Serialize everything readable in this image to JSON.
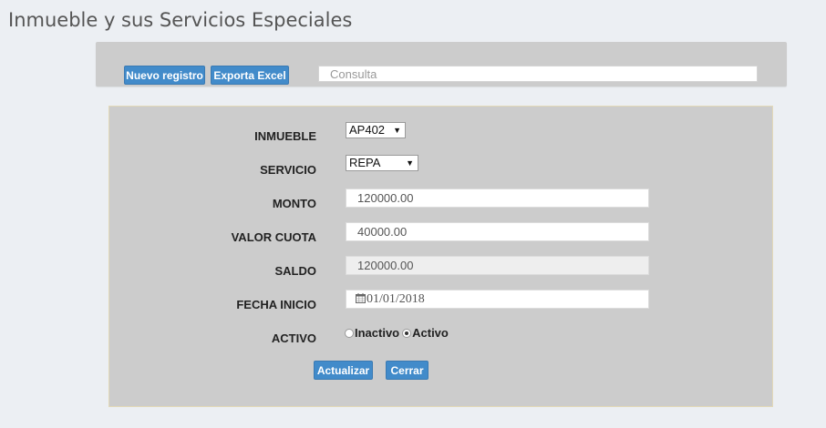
{
  "page": {
    "title": "Inmueble y sus Servicios Especiales"
  },
  "toolbar": {
    "new_label": "Nuevo registro",
    "export_label": "Exporta Excel",
    "search_placeholder": "Consulta"
  },
  "form": {
    "inmueble": {
      "label": "INMUEBLE",
      "value": "AP402"
    },
    "servicio": {
      "label": "SERVICIO",
      "value": "REPA"
    },
    "monto": {
      "label": "MONTO",
      "value": "120000.00"
    },
    "valor_cuota": {
      "label": "VALOR CUOTA",
      "value": "40000.00"
    },
    "saldo": {
      "label": "SALDO",
      "value": "120000.00"
    },
    "fecha_inicio": {
      "label": "FECHA INICIO",
      "value": "01/01/2018"
    },
    "activo": {
      "label": "ACTIVO",
      "options": [
        "Inactivo",
        "Activo"
      ],
      "selected": "Activo"
    },
    "update_label": "Actualizar",
    "close_label": "Cerrar"
  },
  "icons": {
    "calendar": "calendar-icon",
    "dropdown": "dropdown-arrow-icon"
  },
  "colors": {
    "primary_button": "#428bca",
    "panel_bg": "#cccccc",
    "page_bg": "#eceff3"
  }
}
